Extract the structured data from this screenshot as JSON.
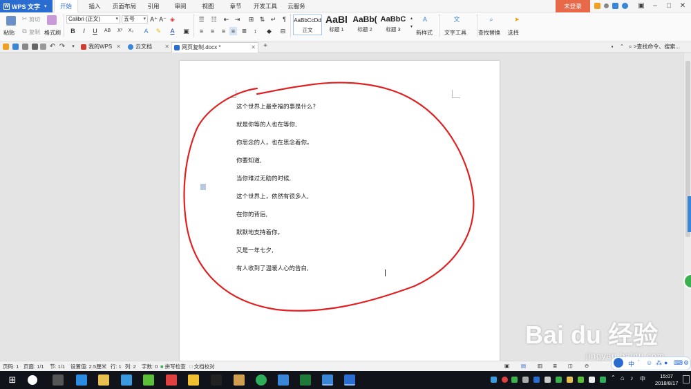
{
  "app": {
    "name": "WPS 文字",
    "login": "未登录"
  },
  "menu_tabs": [
    "开始",
    "插入",
    "页面布局",
    "引用",
    "审阅",
    "视图",
    "章节",
    "开发工具",
    "云服务"
  ],
  "ribbon": {
    "paste": "粘贴",
    "cut": "剪切",
    "copy": "复制",
    "format_painter": "格式刷",
    "font_name": "Calibri (正文)",
    "font_size": "五号",
    "styles": [
      {
        "preview": "AaBbCcDd",
        "label": "正文"
      },
      {
        "preview": "AaBl",
        "label": "标题 1"
      },
      {
        "preview": "AaBb(",
        "label": "标题 2"
      },
      {
        "preview": "AaBbC",
        "label": "标题 3"
      }
    ],
    "new_style": "新样式",
    "text_tools": "文字工具",
    "find_replace": "查找替换",
    "select": "选择"
  },
  "doc_tabs": [
    {
      "label": "我的WPS",
      "color": "#d33b2c"
    },
    {
      "label": "云文档",
      "color": "#3a86d6"
    },
    {
      "label": "网页复制.docx *",
      "color": "#2b6cd0"
    }
  ],
  "command_search": ">查找命令、搜索...",
  "document": {
    "lines": [
      "这个世界上最幸福的事是什么?",
      "就是你等的人也在等你,",
      "你思念的人，也在思念着你。",
      "你要知道,",
      "当你难过无助的时候,",
      "这个世界上，依然有很多人,",
      "在你的背后,",
      "默默地支持着你。",
      "又是一年七夕,",
      "有人收到了温暖人心的告白,"
    ]
  },
  "watermark": {
    "logo": "Bai du 经验",
    "url": "jingyan.baidu.com"
  },
  "statusbar": {
    "items": [
      "页码: 1",
      "页面: 1/1",
      "节: 1/1",
      "设置值: 2.5厘米",
      "行: 1",
      "列: 2",
      "字数: 0",
      "拼写检查",
      "文档校对"
    ]
  },
  "ime": {
    "label": "中"
  },
  "clock": {
    "time": "15:07",
    "date": "2018/8/17"
  },
  "colors": {
    "accent": "#2b6cd0",
    "login": "#e8694a",
    "annotation": "#e02020",
    "taskbar": "#10131a"
  }
}
